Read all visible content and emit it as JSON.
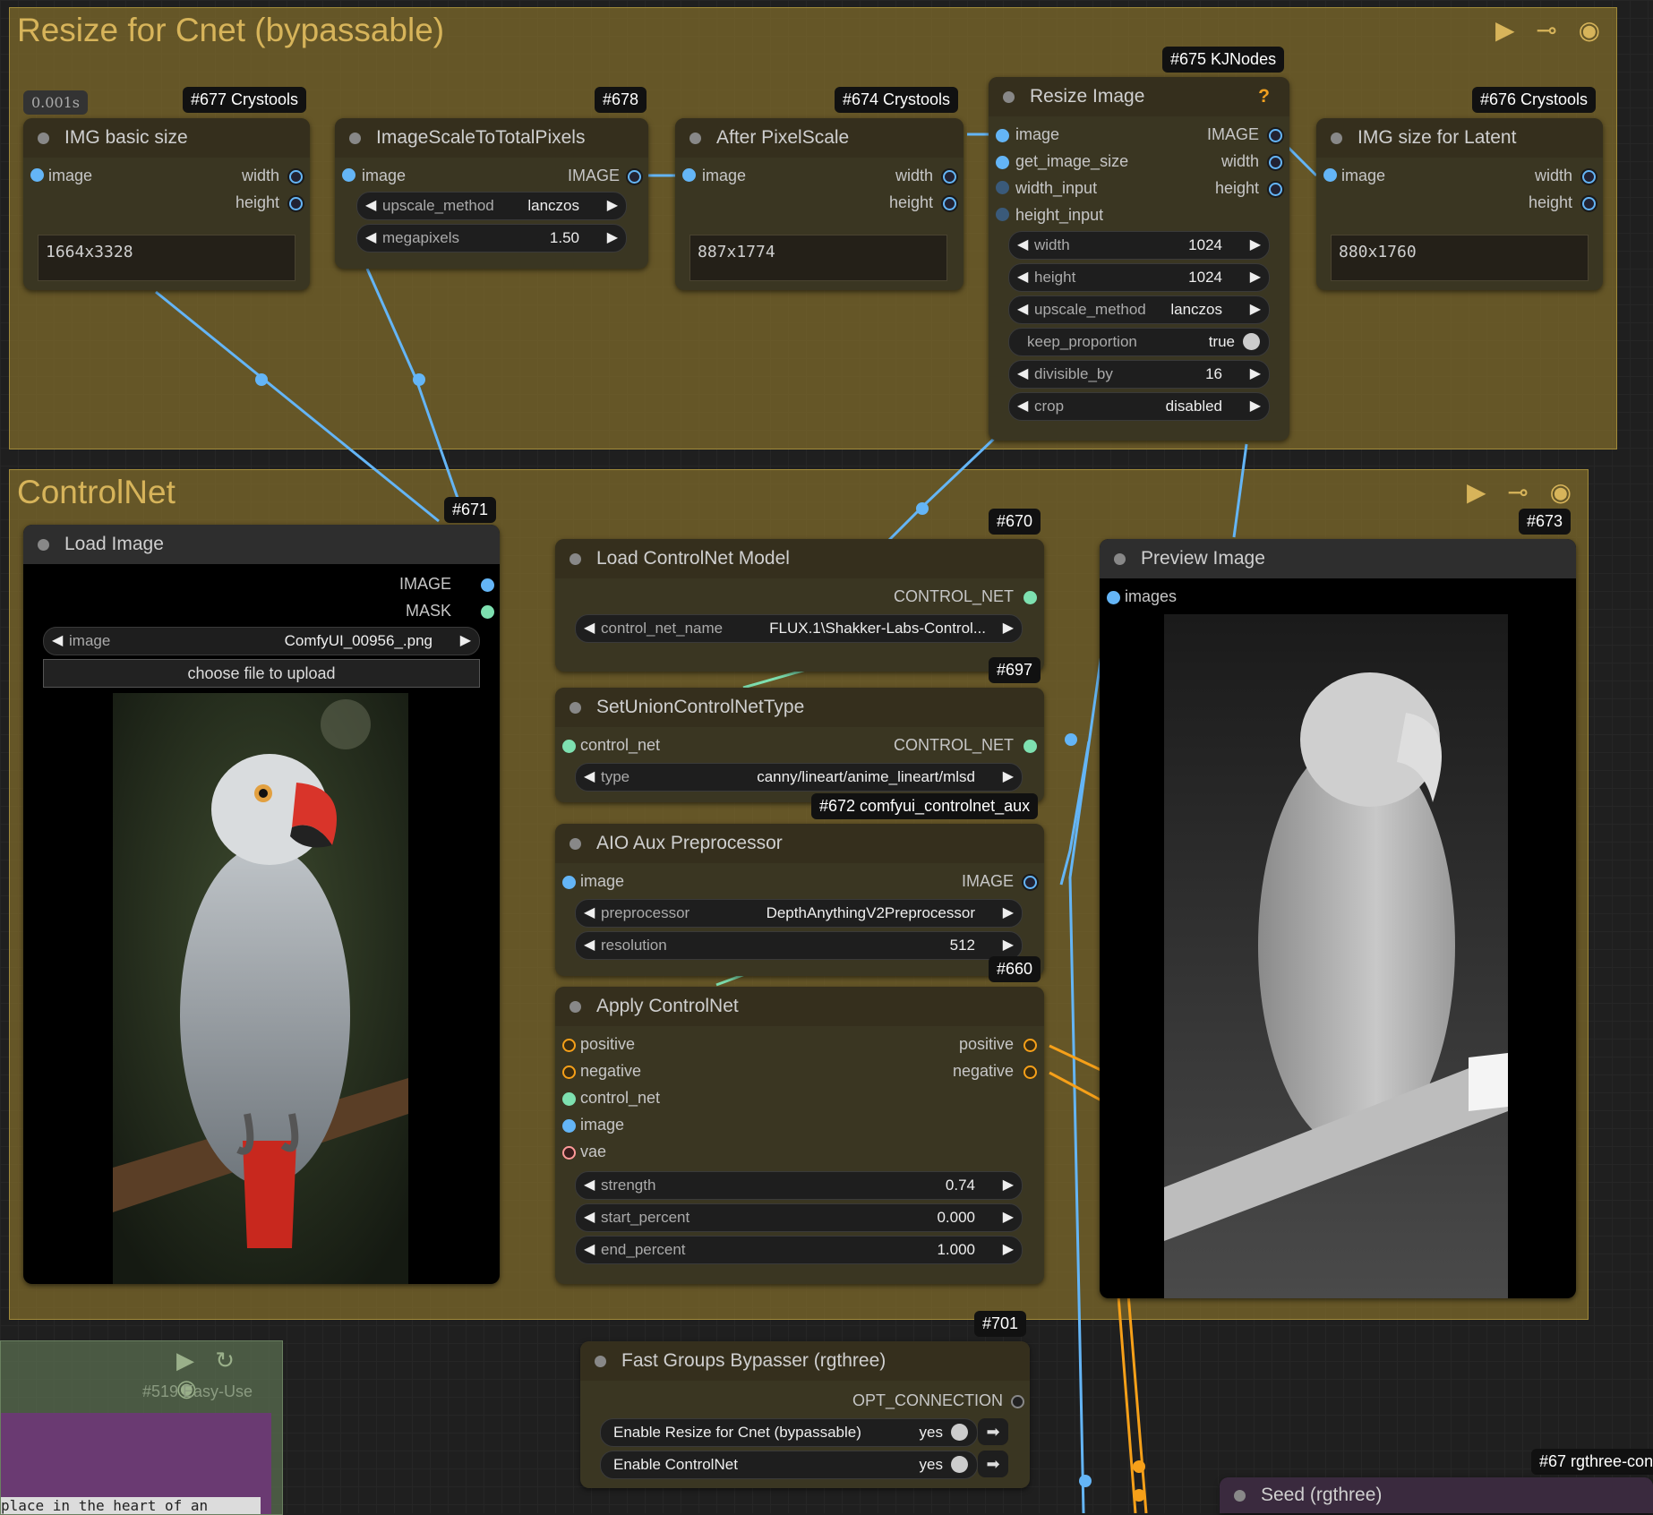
{
  "groups": {
    "resize": {
      "title": "Resize for Cnet (bypassable)",
      "tools": "▶ ⊸ ◉"
    },
    "controlnet": {
      "title": "ControlNet",
      "tools": "▶ ⊸ ◉"
    },
    "easy": {
      "label": "#519 Easy-Use"
    }
  },
  "timer": "0.001s",
  "nodes": {
    "n677": {
      "badge": "#677 Crystools",
      "title": "IMG basic size",
      "in_image": "image",
      "out_width": "width",
      "out_height": "height",
      "value": "1664x3328"
    },
    "n678": {
      "badge": "#678",
      "title": "ImageScaleToTotalPixels",
      "in_image": "image",
      "out_image": "IMAGE",
      "w1_label": "upscale_method",
      "w1_value": "lanczos",
      "w2_label": "megapixels",
      "w2_value": "1.50"
    },
    "n674": {
      "badge": "#674 Crystools",
      "title": "After PixelScale",
      "in_image": "image",
      "out_width": "width",
      "out_height": "height",
      "value": "887x1774"
    },
    "n675": {
      "badge": "#675 KJNodes",
      "title": "Resize Image",
      "help": "?",
      "in1": "image",
      "in2": "get_image_size",
      "in3": "width_input",
      "in4": "height_input",
      "out1": "IMAGE",
      "out2": "width",
      "out3": "height",
      "widgets": [
        {
          "label": "width",
          "value": "1024"
        },
        {
          "label": "height",
          "value": "1024"
        },
        {
          "label": "upscale_method",
          "value": "lanczos"
        },
        {
          "label": "keep_proportion",
          "value": "true"
        },
        {
          "label": "divisible_by",
          "value": "16"
        },
        {
          "label": "crop",
          "value": "disabled"
        }
      ]
    },
    "n676": {
      "badge": "#676 Crystools",
      "title": "IMG size for Latent",
      "in_image": "image",
      "out_width": "width",
      "out_height": "height",
      "value": "880x1760"
    },
    "n671": {
      "badge": "#671",
      "title": "Load Image",
      "out_image": "IMAGE",
      "out_mask": "MASK",
      "w_label": "image",
      "w_value": "ComfyUI_00956_.png",
      "upload": "choose file to upload"
    },
    "n670": {
      "badge": "#670",
      "title": "Load ControlNet Model",
      "out": "CONTROL_NET",
      "w_label": "control_net_name",
      "w_value": "FLUX.1\\Shakker-Labs-Control..."
    },
    "n697": {
      "badge": "#697",
      "title": "SetUnionControlNetType",
      "in": "control_net",
      "out": "CONTROL_NET",
      "w_label": "type",
      "w_value": "canny/lineart/anime_lineart/mlsd"
    },
    "n672": {
      "badge": "#672 comfyui_controlnet_aux",
      "title": "AIO Aux Preprocessor",
      "in": "image",
      "out": "IMAGE",
      "w1_label": "preprocessor",
      "w1_value": "DepthAnythingV2Preprocessor",
      "w2_label": "resolution",
      "w2_value": "512"
    },
    "n660": {
      "badge": "#660",
      "title": "Apply ControlNet",
      "in1": "positive",
      "in2": "negative",
      "in3": "control_net",
      "in4": "image",
      "in5": "vae",
      "out1": "positive",
      "out2": "negative",
      "w1_label": "strength",
      "w1_value": "0.74",
      "w2_label": "start_percent",
      "w2_value": "0.000",
      "w3_label": "end_percent",
      "w3_value": "1.000"
    },
    "n673": {
      "badge": "#673",
      "title": "Preview Image",
      "in": "images"
    },
    "n701": {
      "badge": "#701",
      "title": "Fast Groups Bypasser (rgthree)",
      "out": "OPT_CONNECTION",
      "t1_label": "Enable Resize for Cnet (bypassable)",
      "t1_value": "yes",
      "t2_label": "Enable ControlNet",
      "t2_value": "yes"
    },
    "n67": {
      "badge": "#67 rgthree-con",
      "title": "Seed (rgthree)"
    }
  },
  "misc": {
    "bottom_text": "place in the heart of an"
  },
  "colors": {
    "image_wire": "#64b5f6",
    "cn_wire": "#7ee0b0",
    "cond_wire": "#f6a019",
    "group_fill": "#7a672a"
  }
}
